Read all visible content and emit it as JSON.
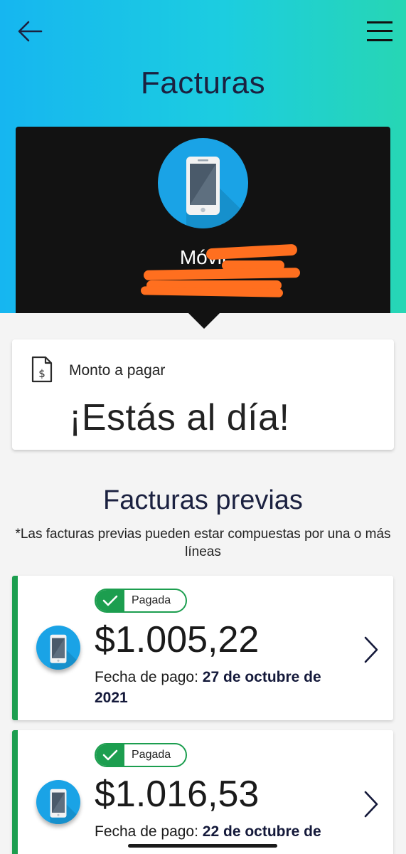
{
  "header": {
    "title": "Facturas",
    "back_icon": "back-arrow-icon",
    "menu_icon": "hamburger-menu-icon"
  },
  "line": {
    "name_visible": "Móvil",
    "icon": "mobile-phone-icon"
  },
  "amount_card": {
    "label": "Monto a pagar",
    "status": "¡Estás al día!",
    "icon": "invoice-dollar-icon"
  },
  "previous": {
    "title": "Facturas previas",
    "note": "*Las facturas previas pueden estar compuestas por una o más líneas",
    "date_label": "Fecha de pago:",
    "items": [
      {
        "status": "Pagada",
        "amount": "$1.005,22",
        "date": "27 de octubre de 2021"
      },
      {
        "status": "Pagada",
        "amount": "$1.016,53",
        "date": "22 de octubre de"
      }
    ]
  },
  "colors": {
    "gradient_start": "#16b6f0",
    "gradient_end": "#27d6b4",
    "paid_green": "#1c9e4f",
    "navy": "#1b2140",
    "redaction_orange": "#ff6f1f"
  }
}
